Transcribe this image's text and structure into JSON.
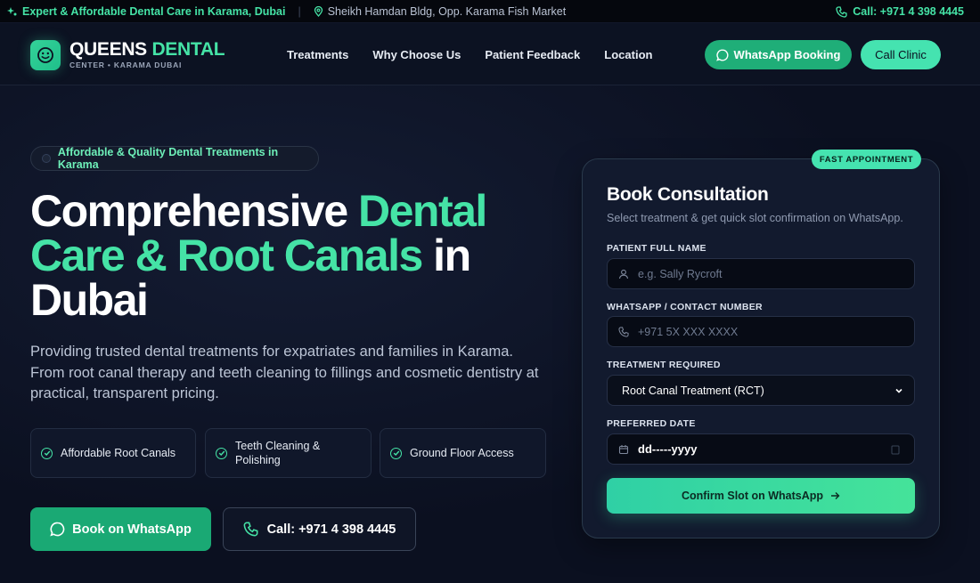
{
  "topbar": {
    "tagline": "Expert & Affordable Dental Care in Karama, Dubai",
    "separator": "|",
    "address": "Sheikh Hamdan Bldg, Opp. Karama Fish Market",
    "phone": "Call: +971 4 398 4445"
  },
  "nav": {
    "brand_main": "QUEENS",
    "brand_accent": "DENTAL",
    "brand_sub": "CENTER • KARAMA DUBAI",
    "links": [
      "Treatments",
      "Why Choose Us",
      "Patient Feedback",
      "Location"
    ],
    "whatsapp_button": "WhatsApp Booking",
    "call_button": "Call Clinic"
  },
  "hero": {
    "pill": "Affordable & Quality Dental Treatments in Karama",
    "title_1": "Comprehensive ",
    "title_accent": "Dental Care & Root Canals",
    "title_2": " in Dubai",
    "description": "Providing trusted dental treatments for expatriates and families in Karama. From root canal therapy and teeth cleaning to fillings and cosmetic dentistry at practical, transparent pricing.",
    "features": [
      "Affordable Root Canals",
      "Teeth Cleaning & Polishing",
      "Ground Floor Access"
    ],
    "book_button": "Book on WhatsApp",
    "call_button": "Call: +971 4 398 4445"
  },
  "form": {
    "badge": "FAST APPOINTMENT",
    "title": "Book Consultation",
    "subtitle": "Select treatment & get quick slot confirmation on WhatsApp.",
    "name_label": "PATIENT FULL NAME",
    "name_placeholder": "e.g. Sally Rycroft",
    "phone_label": "WHATSAPP / CONTACT NUMBER",
    "phone_placeholder": "+971 5X XXX XXXX",
    "treatment_label": "TREATMENT REQUIRED",
    "treatment_value": "Root Canal Treatment (RCT)",
    "date_label": "PREFERRED DATE",
    "date_value": "dd-----yyyy",
    "submit": "Confirm Slot on WhatsApp"
  },
  "colors": {
    "accent": "#45e3a6",
    "background": "#0b1020",
    "whatsapp_green": "#1fae78"
  },
  "icons": {
    "topbar_tagline": "sparkle-icon",
    "topbar_address": "map-pin-icon",
    "topbar_phone": "phone-icon",
    "logo": "smile-icon",
    "whatsapp": "whatsapp-icon",
    "feature": "check-circle-icon",
    "name_field": "user-icon",
    "phone_field": "phone-icon",
    "date_field": "calendar-icon",
    "submit": "arrow-right-icon"
  }
}
